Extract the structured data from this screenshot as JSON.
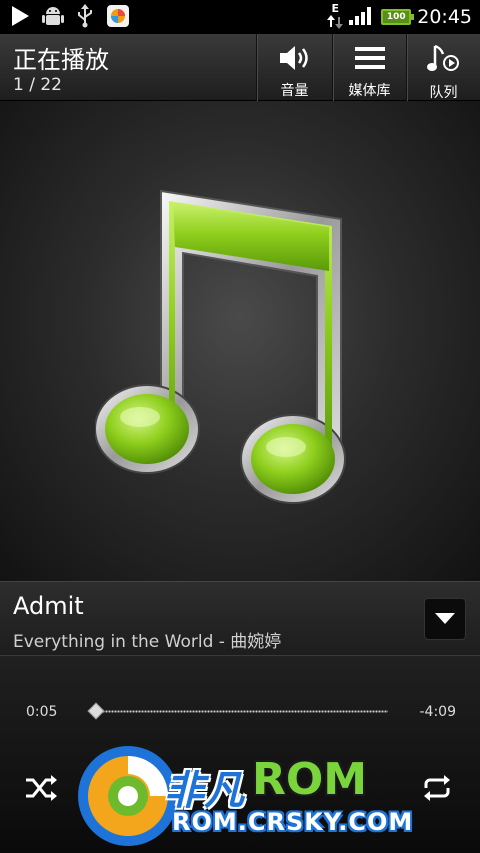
{
  "status_bar": {
    "network_type": "E",
    "battery_level": "100",
    "clock": "20:45",
    "icons": [
      "play-icon",
      "android-debug-icon",
      "usb-icon",
      "photo-app-icon",
      "data-transfer-icon",
      "signal-icon",
      "battery-icon"
    ]
  },
  "header": {
    "title": "正在播放",
    "track_position": "1 / 22",
    "buttons": {
      "volume": "音量",
      "library": "媒体库",
      "queue": "队列"
    }
  },
  "album_art": {
    "icon": "music-note-icon",
    "accent_color": "#8fcf1d"
  },
  "track": {
    "title": "Admit",
    "album_artist": "Everything in the World - 曲婉婷"
  },
  "playback": {
    "elapsed": "0:05",
    "remaining": "-4:09",
    "progress": 0.02
  },
  "watermark": {
    "brand_cn": "非凡",
    "brand_en": "ROM",
    "url": "ROM.CRSKY.COM"
  }
}
